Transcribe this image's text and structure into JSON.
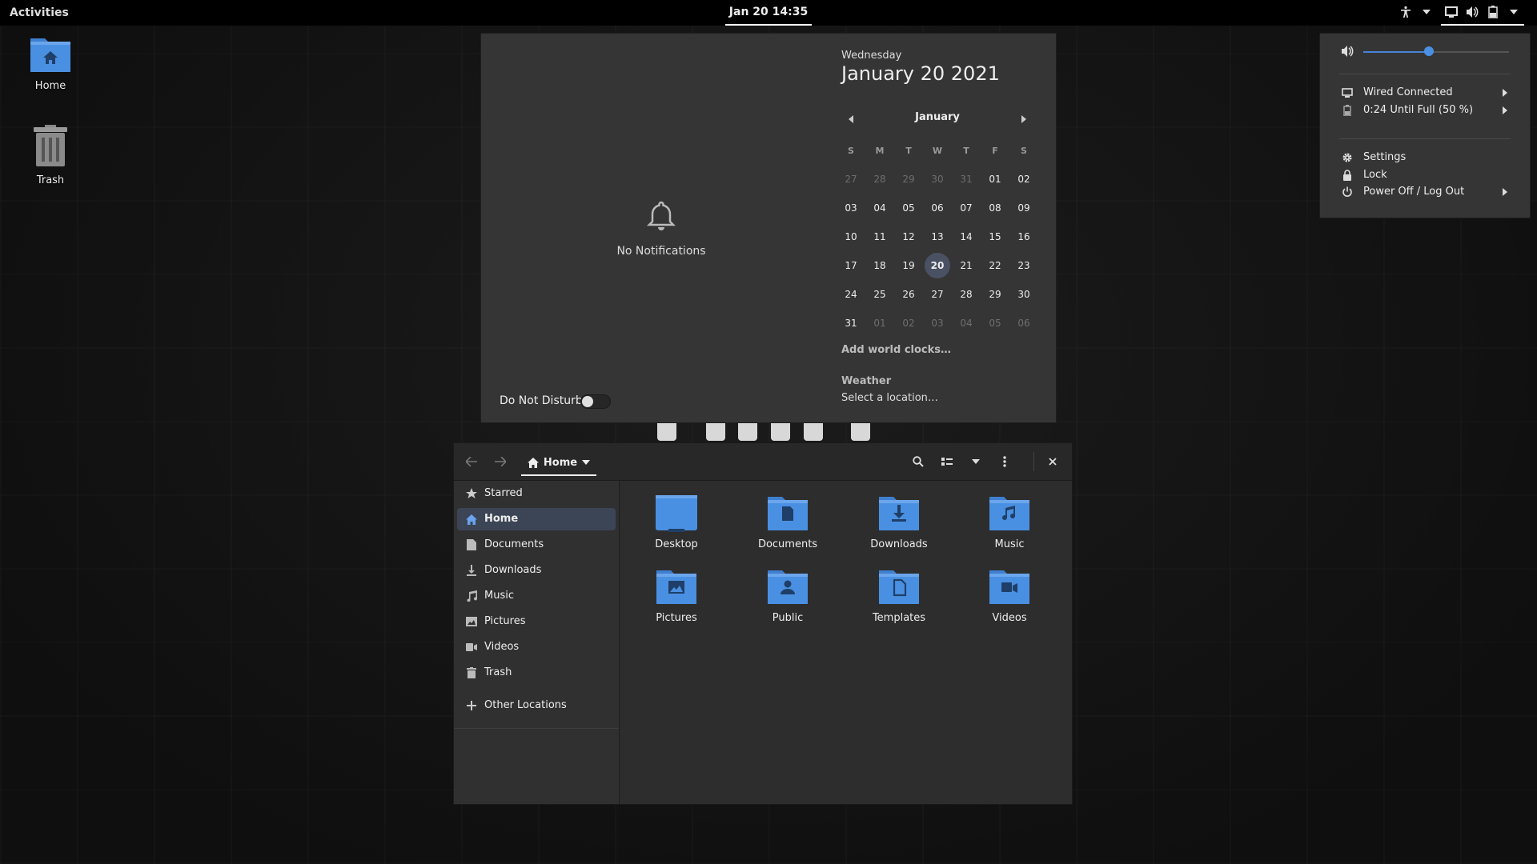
{
  "topbar": {
    "activities": "Activities",
    "clock": "Jan 20  14:35"
  },
  "desktop": {
    "icons": [
      {
        "label": "Home"
      },
      {
        "label": "Trash"
      }
    ]
  },
  "calendar_popup": {
    "no_notifications": "No Notifications",
    "dnd_label": "Do Not Disturb",
    "dnd_on": false,
    "weekday": "Wednesday",
    "date": "January 20 2021",
    "month": "January",
    "day_headers": [
      "S",
      "M",
      "T",
      "W",
      "T",
      "F",
      "S"
    ],
    "weeks": [
      [
        "27",
        "28",
        "29",
        "30",
        "31",
        "01",
        "02"
      ],
      [
        "03",
        "04",
        "05",
        "06",
        "07",
        "08",
        "09"
      ],
      [
        "10",
        "11",
        "12",
        "13",
        "14",
        "15",
        "16"
      ],
      [
        "17",
        "18",
        "19",
        "20",
        "21",
        "22",
        "23"
      ],
      [
        "24",
        "25",
        "26",
        "27",
        "28",
        "29",
        "30"
      ],
      [
        "31",
        "01",
        "02",
        "03",
        "04",
        "05",
        "06"
      ]
    ],
    "today": "20",
    "world_clocks": "Add world clocks…",
    "weather_heading": "Weather",
    "weather_location": "Select a location…"
  },
  "system_menu": {
    "volume_level": 0.45,
    "accent": "#4a90e2",
    "items": [
      {
        "label": "Wired Connected",
        "icon": "network-wired-icon"
      },
      {
        "label": "0:24 Until Full (50 %)",
        "icon": "battery-icon"
      },
      {
        "label": "Settings",
        "icon": "gear-icon"
      },
      {
        "label": "Lock",
        "icon": "lock-icon"
      },
      {
        "label": "Power Off / Log Out",
        "icon": "power-icon"
      }
    ]
  },
  "file_manager": {
    "path": "Home",
    "sidebar": [
      {
        "label": "Starred",
        "icon": "star-icon"
      },
      {
        "label": "Home",
        "icon": "home-icon",
        "active": true
      },
      {
        "label": "Documents",
        "icon": "document-icon"
      },
      {
        "label": "Downloads",
        "icon": "download-icon"
      },
      {
        "label": "Music",
        "icon": "music-icon"
      },
      {
        "label": "Pictures",
        "icon": "picture-icon"
      },
      {
        "label": "Videos",
        "icon": "video-icon"
      },
      {
        "label": "Trash",
        "icon": "trash-icon"
      },
      {
        "label": "Other Locations",
        "icon": "plus-icon"
      }
    ],
    "folders": [
      {
        "label": "Desktop",
        "icon": "desktop-folder-icon"
      },
      {
        "label": "Documents",
        "icon": "documents-folder-icon"
      },
      {
        "label": "Downloads",
        "icon": "downloads-folder-icon"
      },
      {
        "label": "Music",
        "icon": "music-folder-icon"
      },
      {
        "label": "Pictures",
        "icon": "pictures-folder-icon"
      },
      {
        "label": "Public",
        "icon": "public-folder-icon"
      },
      {
        "label": "Templates",
        "icon": "templates-folder-icon"
      },
      {
        "label": "Videos",
        "icon": "videos-folder-icon"
      }
    ]
  }
}
